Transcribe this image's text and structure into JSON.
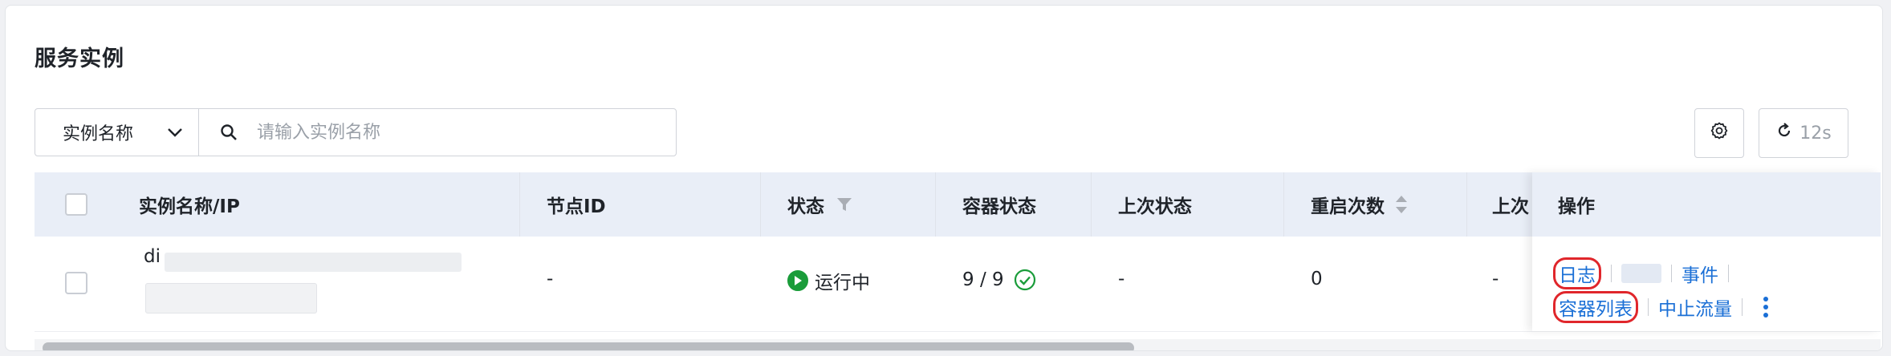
{
  "card": {
    "title": "服务实例"
  },
  "toolbar": {
    "field_select": "实例名称",
    "search_placeholder": "请输入实例名称",
    "refresh_label": "12s"
  },
  "table": {
    "columns": [
      "实例名称/IP",
      "节点ID",
      "状态",
      "容器状态",
      "上次状态",
      "重启次数",
      "上次"
    ],
    "action_header": "操作",
    "row": {
      "name_prefix": "di",
      "node_id": "-",
      "status": "运行中",
      "container_status": "9 / 9",
      "last_status": "-",
      "restart_count": "0",
      "last_col": "-"
    },
    "actions": {
      "logs": "日志",
      "events": "事件",
      "container_list": "容器列表",
      "stop_traffic": "中止流量"
    }
  },
  "colors": {
    "accent": "#1a6fd6",
    "running": "#1a9c3a",
    "highlight": "#e0262b"
  }
}
